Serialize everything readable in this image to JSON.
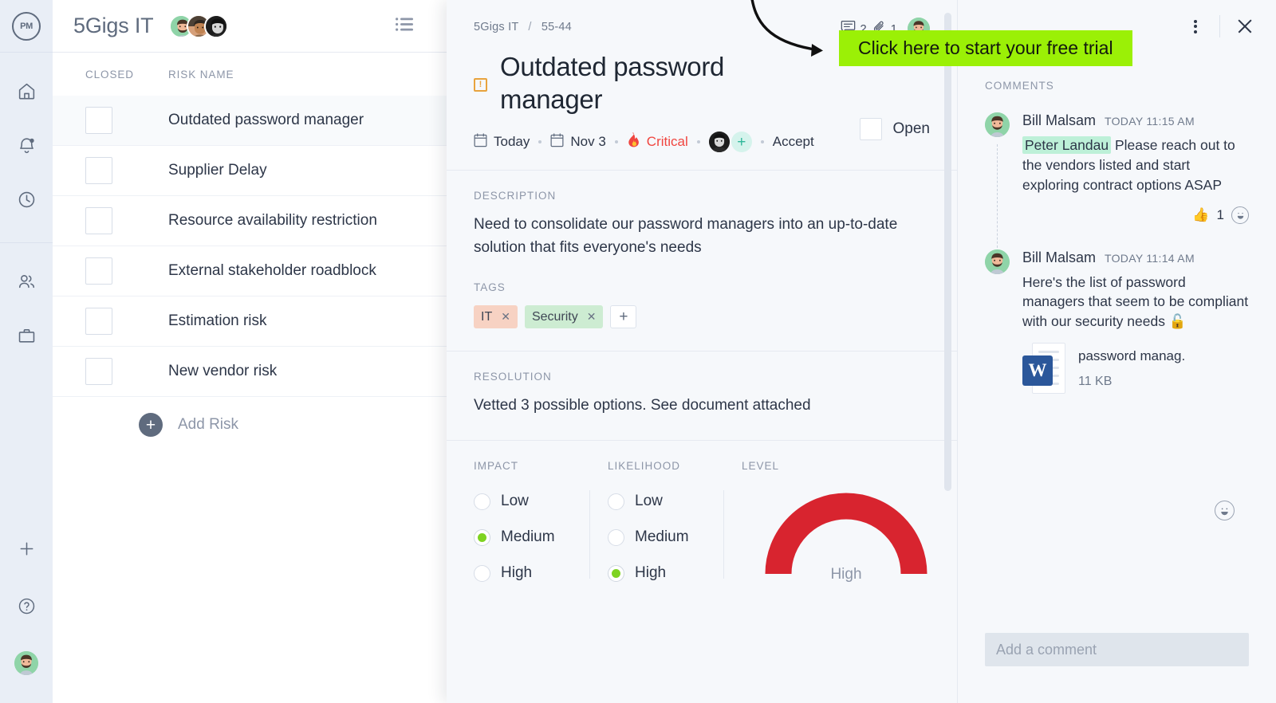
{
  "rail": {
    "logo_text": "PM",
    "items": [
      {
        "name": "home",
        "icon": "home-icon"
      },
      {
        "name": "notifications",
        "icon": "bell-icon"
      },
      {
        "name": "timesheets",
        "icon": "clock-icon"
      },
      {
        "name": "team",
        "icon": "people-icon"
      },
      {
        "name": "portfolio",
        "icon": "briefcase-icon"
      }
    ],
    "bottom": [
      {
        "name": "add",
        "icon": "plus-icon"
      },
      {
        "name": "help",
        "icon": "question-circle-icon"
      },
      {
        "name": "profile",
        "icon": "user-avatar"
      }
    ]
  },
  "list": {
    "project_title": "5Gigs IT",
    "columns": {
      "closed": "CLOSED",
      "risk_name": "RISK NAME"
    },
    "rows": [
      {
        "name": "Outdated password manager",
        "closed": false,
        "active": true
      },
      {
        "name": "Supplier Delay",
        "closed": false,
        "active": false
      },
      {
        "name": "Resource availability restriction",
        "closed": false,
        "active": false
      },
      {
        "name": "External stakeholder roadblock",
        "closed": false,
        "active": false
      },
      {
        "name": "Estimation risk",
        "closed": false,
        "active": false
      },
      {
        "name": "New vendor risk",
        "closed": false,
        "active": false
      }
    ],
    "add_risk_label": "Add Risk"
  },
  "detail": {
    "breadcrumb": {
      "project": "5Gigs IT",
      "separator": "/",
      "id": "55-44"
    },
    "stats": {
      "comment_count": "2",
      "attachment_count": "1"
    },
    "title": "Outdated password manager",
    "status": {
      "label": "Open",
      "checked": false
    },
    "meta": {
      "start_date": "Today",
      "due_date": "Nov 3",
      "priority": "Critical",
      "priority_color": "#f0453f",
      "action": "Accept",
      "add_assignee": "+"
    },
    "description": {
      "label": "DESCRIPTION",
      "text": "Need to consolidate our password managers into an up-to-date solution that fits everyone's needs"
    },
    "tags": {
      "label": "TAGS",
      "items": [
        {
          "text": "IT",
          "color": "#f7d2c3",
          "remove": "✕"
        },
        {
          "text": "Security",
          "color": "#cdecd2",
          "remove": "✕"
        }
      ],
      "add": "+"
    },
    "resolution": {
      "label": "RESOLUTION",
      "text": "Vetted 3 possible options. See document attached"
    },
    "impact": {
      "label": "IMPACT",
      "options": [
        "Low",
        "Medium",
        "High"
      ],
      "selected": "Medium"
    },
    "likelihood": {
      "label": "LIKELIHOOD",
      "options": [
        "Low",
        "Medium",
        "High"
      ],
      "selected": "High"
    },
    "level": {
      "label": "LEVEL",
      "value": "High",
      "color": "#d8242f"
    }
  },
  "comments": {
    "label": "COMMENTS",
    "items": [
      {
        "author": "Bill Malsam",
        "time": "TODAY 11:15 AM",
        "mention": "Peter Landau",
        "text": "Please reach out to the vendors listed and start exploring contract options ASAP",
        "reaction_emoji": "👍",
        "reaction_count": "1"
      },
      {
        "author": "Bill Malsam",
        "time": "TODAY 11:14 AM",
        "text": "Here's the list of password managers that seem to be compliant with our security needs 🔓",
        "attachment": {
          "file_type": "W",
          "name": "password manag.",
          "size": "11 KB"
        }
      }
    ],
    "input_placeholder": "Add a comment"
  },
  "cta": {
    "banner_text": "Click here to start your free trial",
    "banner_color": "#9bf006"
  }
}
